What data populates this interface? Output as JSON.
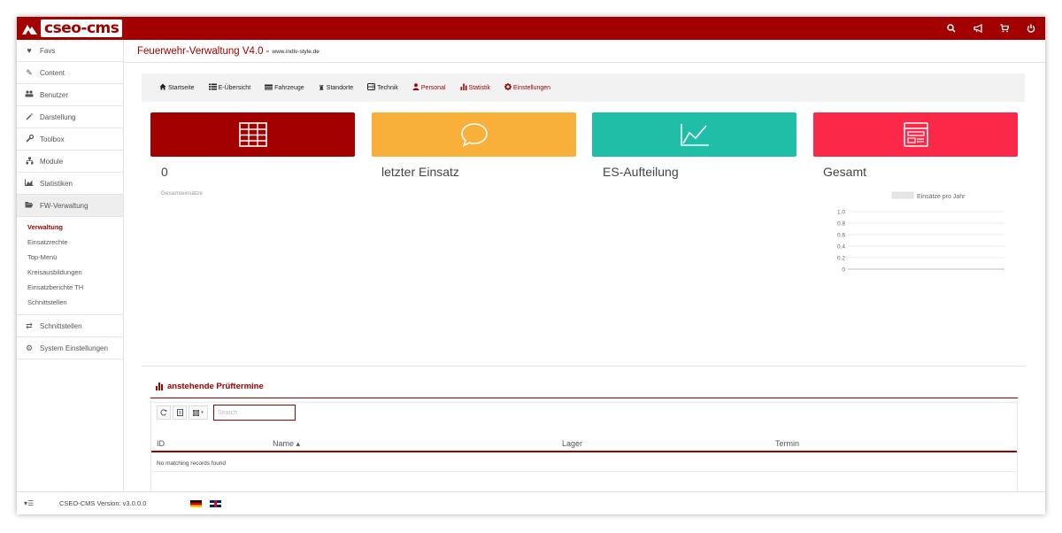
{
  "brand": {
    "logo_text": "cseo-cms"
  },
  "topbar": {
    "icons": [
      {
        "name": "search-icon",
        "glyph": "⌕"
      },
      {
        "name": "megaphone-icon",
        "glyph": "📢"
      },
      {
        "name": "cart-icon",
        "glyph": "🛒"
      },
      {
        "name": "power-icon",
        "glyph": "⏻"
      }
    ]
  },
  "sidebar": {
    "items": [
      {
        "label": "Favs",
        "icon": "heart-icon",
        "glyph": "♥"
      },
      {
        "label": "Content",
        "icon": "pencil-icon",
        "glyph": "✎"
      },
      {
        "label": "Benutzer",
        "icon": "users-icon",
        "glyph": "👥"
      },
      {
        "label": "Darstellung",
        "icon": "magic-icon",
        "glyph": "⚒"
      },
      {
        "label": "Toolbox",
        "icon": "wrench-icon",
        "glyph": "🔧"
      },
      {
        "label": "Module",
        "icon": "sitemap-icon",
        "glyph": "⧉"
      },
      {
        "label": "Statistiken",
        "icon": "chart-icon",
        "glyph": "📈"
      },
      {
        "label": "FW-Verwaltung",
        "icon": "folder-open-icon",
        "glyph": "📂"
      }
    ],
    "subitems": [
      {
        "label": "Verwaltung",
        "active": true
      },
      {
        "label": "Einsatzrechte"
      },
      {
        "label": "Top-Menü"
      },
      {
        "label": "Kreisausbildungen"
      },
      {
        "label": "Einsatzberichte TH"
      },
      {
        "label": "Schnittstellen"
      }
    ],
    "items_after": [
      {
        "label": "Schnittstellen",
        "icon": "exchange-icon",
        "glyph": "⇄"
      },
      {
        "label": "System Einstellungen",
        "icon": "cogs-icon",
        "glyph": "⚙"
      }
    ]
  },
  "header": {
    "title": "Feuerwehr-Verwaltung V4.0",
    "separator": "-",
    "url": "www.indiv-style.de"
  },
  "nav": {
    "links": [
      {
        "label": "Startseite",
        "icon": "home-icon",
        "glyph": "⌂",
        "red": false
      },
      {
        "label": "E-Übersicht",
        "icon": "list-icon",
        "glyph": "☰",
        "red": false
      },
      {
        "label": "Fahrzeuge",
        "icon": "truck-icon",
        "glyph": "▬",
        "red": false
      },
      {
        "label": "Standorte",
        "icon": "building-icon",
        "glyph": "♜",
        "red": false
      },
      {
        "label": "Technik",
        "icon": "hdd-icon",
        "glyph": "⊟",
        "red": false
      },
      {
        "label": "Personal",
        "icon": "user-icon",
        "glyph": "👤",
        "red": true
      },
      {
        "label": "Statistik",
        "icon": "bar-chart-icon",
        "glyph": "▮",
        "red": true
      },
      {
        "label": "Einstellungen",
        "icon": "cog-icon",
        "glyph": "✿",
        "red": true
      }
    ]
  },
  "tiles": [
    {
      "label": "0",
      "sub": "Gesamteinsätze",
      "color": "#a30000",
      "icon": "table-icon"
    },
    {
      "label": "letzter Einsatz",
      "color": "#f9b03b",
      "icon": "comment-icon"
    },
    {
      "label": "ES-Aufteilung",
      "color": "#1fbfa7",
      "icon": "area-chart-icon"
    },
    {
      "label": "Gesamt",
      "color": "#fb2848",
      "icon": "window-icon"
    }
  ],
  "chart_data": {
    "type": "line",
    "legend": "Einsätze pro Jahr",
    "legend_placement": "top",
    "ylim": [
      0,
      1.0
    ],
    "yticks": [
      "1.0",
      "0.8",
      "0.6",
      "0.4",
      "0.2",
      "0"
    ],
    "series": [
      {
        "name": "Einsätze pro Jahr",
        "values": []
      }
    ],
    "grid": true
  },
  "panel": {
    "title": "anstehende Prüftermine",
    "search_placeholder": "Search",
    "columns": [
      "ID",
      "Name ▴",
      "Lager",
      "Termin"
    ],
    "empty_message": "No matching records found"
  },
  "footer": {
    "version": "CSEO-CMS Version: v3.0.0.0",
    "menu_glyph": "▾☰"
  },
  "colors": {
    "brand": "#a30000",
    "tile_red": "#a30000",
    "tile_orange": "#f9b03b",
    "tile_teal": "#1fbfa7",
    "tile_pink": "#fb2848"
  }
}
